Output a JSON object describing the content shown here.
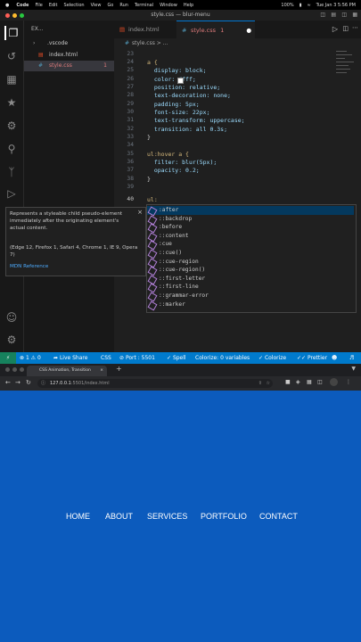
{
  "menubar": {
    "apple": "",
    "items": [
      "Code",
      "File",
      "Edit",
      "Selection",
      "View",
      "Go",
      "Run",
      "Terminal",
      "Window",
      "Help"
    ],
    "battery": "100%",
    "datetime": "Tue Jan 3  5:56 PM"
  },
  "window": {
    "title": "style.css — blur-menu"
  },
  "sidebar": {
    "header": "EX...",
    "items": [
      {
        "label": ".vscode",
        "icon": "chevron-right-icon"
      },
      {
        "label": "index.html",
        "icon": "html-file-icon"
      },
      {
        "label": "style.css",
        "badge": "1",
        "icon": "css-file-icon"
      }
    ]
  },
  "tabs": [
    {
      "label": "index.html",
      "active": false
    },
    {
      "label": "style.css",
      "badge": "1",
      "modified": true,
      "active": true
    }
  ],
  "breadcrumb": "style.css > ...",
  "code_lines": [
    {
      "n": "23",
      "text": ""
    },
    {
      "n": "24",
      "text": "a {"
    },
    {
      "n": "25",
      "text": "  display: block;"
    },
    {
      "n": "26",
      "text": "  color: #fff;"
    },
    {
      "n": "27",
      "text": "  position: relative;"
    },
    {
      "n": "28",
      "text": "  text-decoration: none;"
    },
    {
      "n": "29",
      "text": "  padding: 5px;"
    },
    {
      "n": "30",
      "text": "  font-size: 22px;"
    },
    {
      "n": "31",
      "text": "  text-transform: uppercase;"
    },
    {
      "n": "32",
      "text": "  transition: all 0.3s;"
    },
    {
      "n": "33",
      "text": "}"
    },
    {
      "n": "34",
      "text": ""
    },
    {
      "n": "35",
      "text": "ul:hover a {"
    },
    {
      "n": "36",
      "text": "  filter: blur(5px);"
    },
    {
      "n": "37",
      "text": "  opacity: 0.2;"
    },
    {
      "n": "38",
      "text": "}"
    },
    {
      "n": "39",
      "text": ""
    },
    {
      "n": "40",
      "text": "ul:"
    }
  ],
  "hover_doc": {
    "description": "Represents a styleable child pseudo-element immediately after the originating element's actual content.",
    "compat": "(Edge 12, Firefox 1, Safari 4, Chrome 1, IE 9, Opera 7)",
    "link": "MDN Reference"
  },
  "suggestions": [
    ":after",
    "::backdrop",
    ":before",
    "::content",
    ":cue",
    "::cue()",
    "::cue-region",
    "::cue-region()",
    "::first-letter",
    "::first-line",
    "::grammar-error",
    "::marker"
  ],
  "statusbar": {
    "remote": "⚡",
    "errors": "1",
    "warnings": "0",
    "live_share": "Live Share",
    "language": "CSS",
    "port": "Port : 5501",
    "spell": "Spell",
    "colorize": "Colorize: 0 variables",
    "colorize_btn": "Colorize",
    "prettier": "Prettier"
  },
  "browser": {
    "tab_title": "CSS Animation, Transition",
    "url_host": "127.0.0.1",
    "url_path": ":5501/index.html",
    "nav_items": [
      "HOME",
      "ABOUT",
      "SERVICES",
      "PORTFOLIO",
      "CONTACT"
    ],
    "bg_color": "#0c5bbd"
  }
}
